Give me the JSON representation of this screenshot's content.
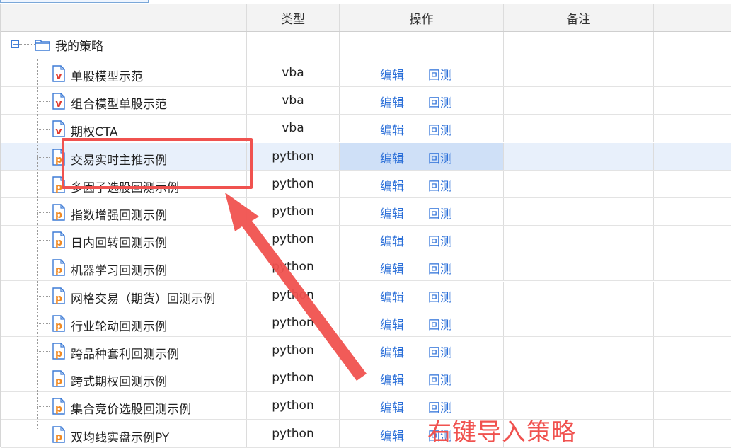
{
  "columns": {
    "type": "类型",
    "operation": "操作",
    "note": "备注"
  },
  "root": {
    "label": "我的策略",
    "toggle": "−"
  },
  "ops": {
    "edit": "编辑",
    "backtest": "回测"
  },
  "rows": [
    {
      "name": "单股模型示范",
      "type": "vba",
      "icon": "vba-file-icon"
    },
    {
      "name": "组合模型单股示范",
      "type": "vba",
      "icon": "vba-file-icon"
    },
    {
      "name": "期权CTA",
      "type": "vba",
      "icon": "vba-file-icon"
    },
    {
      "name": "交易实时主推示例",
      "type": "python",
      "icon": "python-file-icon"
    },
    {
      "name": "多因子选股回测示例",
      "type": "python",
      "icon": "python-file-icon"
    },
    {
      "name": "指数增强回测示例",
      "type": "python",
      "icon": "python-file-icon"
    },
    {
      "name": "日内回转回测示例",
      "type": "python",
      "icon": "python-file-icon"
    },
    {
      "name": "机器学习回测示例",
      "type": "python",
      "icon": "python-file-icon"
    },
    {
      "name": "网格交易（期货）回测示例",
      "type": "python",
      "icon": "python-file-icon"
    },
    {
      "name": "行业轮动回测示例",
      "type": "python",
      "icon": "python-file-icon"
    },
    {
      "name": "跨品种套利回测示例",
      "type": "python",
      "icon": "python-file-icon"
    },
    {
      "name": "跨式期权回测示例",
      "type": "python",
      "icon": "python-file-icon"
    },
    {
      "name": "集合竞价选股回测示例",
      "type": "python",
      "icon": "python-file-icon"
    },
    {
      "name": "双均线实盘示例PY",
      "type": "python",
      "icon": "python-file-icon"
    }
  ],
  "annotation": {
    "text": "右键导入策略"
  },
  "colors": {
    "link": "#2b6fd8",
    "accent": "#f0524f",
    "vba": "#e03a2f",
    "python": "#f08a24",
    "icon_blue": "#3d7bd6"
  }
}
